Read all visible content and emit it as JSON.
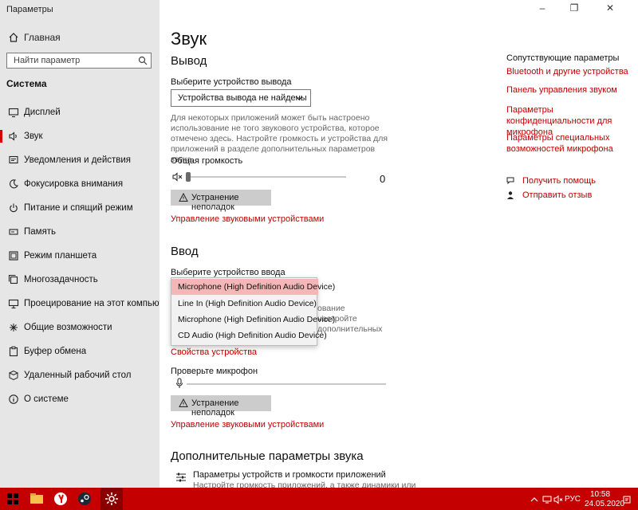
{
  "window": {
    "title": "Параметры"
  },
  "sidebar": {
    "home": "Главная",
    "search_placeholder": "Найти параметр",
    "section_title": "Система",
    "items": [
      {
        "label": "Дисплей",
        "icon": "display-icon"
      },
      {
        "label": "Звук",
        "icon": "speaker-icon",
        "active": true
      },
      {
        "label": "Уведомления и действия",
        "icon": "notifications-icon"
      },
      {
        "label": "Фокусировка внимания",
        "icon": "moon-icon"
      },
      {
        "label": "Питание и спящий режим",
        "icon": "power-icon"
      },
      {
        "label": "Память",
        "icon": "storage-icon"
      },
      {
        "label": "Режим планшета",
        "icon": "tablet-icon"
      },
      {
        "label": "Многозадачность",
        "icon": "multitask-icon"
      },
      {
        "label": "Проецирование на этот компьютер",
        "icon": "project-icon"
      },
      {
        "label": "Общие возможности",
        "icon": "shared-icon"
      },
      {
        "label": "Буфер обмена",
        "icon": "clipboard-icon"
      },
      {
        "label": "Удаленный рабочий стол",
        "icon": "remote-icon"
      },
      {
        "label": "О системе",
        "icon": "info-icon"
      }
    ]
  },
  "main": {
    "title": "Звук",
    "output": {
      "heading": "Вывод",
      "choose_label": "Выберите устройство вывода",
      "selected_device": "Устройства вывода не найдены",
      "description": "Для некоторых приложений может быть настроено использование не того звукового устройства, которое отмечено здесь. Настройте громкость и устройства для приложений в разделе дополнительных параметров звука.",
      "volume_label": "Общая громкость",
      "volume_value": "0",
      "troubleshoot": "Устранение неполадок",
      "manage_link": "Управление звуковыми устройствами"
    },
    "input": {
      "heading": "Ввод",
      "choose_label": "Выберите устройство ввода",
      "dropdown_options": [
        "Microphone (High Definition Audio Device)",
        "Line In (High Definition Audio Device)",
        "Microphone (High Definition Audio Device)",
        "CD Audio (High Definition Audio Device)"
      ],
      "partial_desc_lines": [
        "ование",
        "настройте",
        "дополнительных"
      ],
      "device_props_link": "Свойства устройства",
      "test_mic_label": "Проверьте микрофон",
      "troubleshoot": "Устранение неполадок",
      "manage_link": "Управление звуковыми устройствами"
    },
    "advanced": {
      "heading": "Дополнительные параметры звука",
      "app_volume_title": "Параметры устройств и громкости приложений",
      "app_volume_desc": "Настройте громкость приложений, а также динамики или"
    }
  },
  "related": {
    "title": "Сопутствующие параметры",
    "links": [
      "Bluetooth и другие устройства",
      "Панель управления звуком",
      "Параметры конфиденциальности для микрофона",
      "Параметры специальных возможностей микрофона"
    ],
    "get_help": "Получить помощь",
    "feedback": "Отправить отзыв"
  },
  "taskbar": {
    "lang": "РУС",
    "time": "10:58",
    "date": "24.05.2020"
  },
  "colors": {
    "accent": "#c00000",
    "taskbar": "#c40000",
    "sidebar_bg": "#e6e6e6",
    "selected_item": "#f4b6b6"
  }
}
